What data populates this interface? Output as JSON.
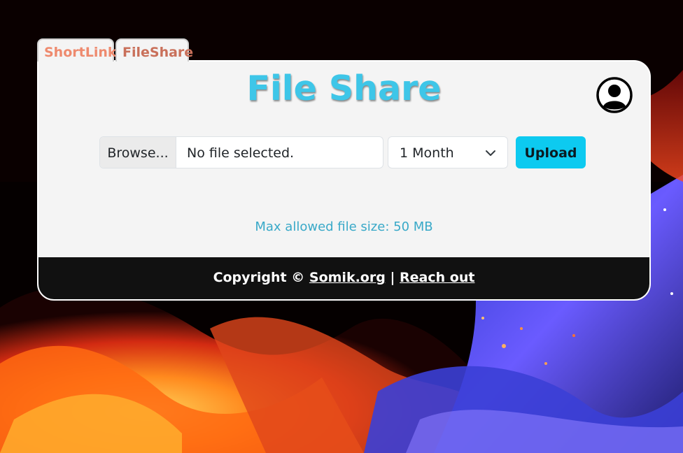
{
  "tabs": [
    {
      "label": "ShortLink",
      "color": "#ee8a6e"
    },
    {
      "label": "FileShare",
      "color": "#c9705a"
    }
  ],
  "header": {
    "title": "File Share",
    "title_color": "#3ec6e8",
    "avatar_icon": "user-circle-icon"
  },
  "upload": {
    "browse_label": "Browse...",
    "file_name": "No file selected.",
    "duration_selected": "1 Month",
    "upload_label": "Upload",
    "accent": "#0dcaf0"
  },
  "info": {
    "max_size": "Max allowed file size: 50 MB"
  },
  "footer": {
    "prefix": "Copyright ©",
    "site_link": "Somik.org",
    "separator": "|",
    "contact_link": "Reach out"
  }
}
